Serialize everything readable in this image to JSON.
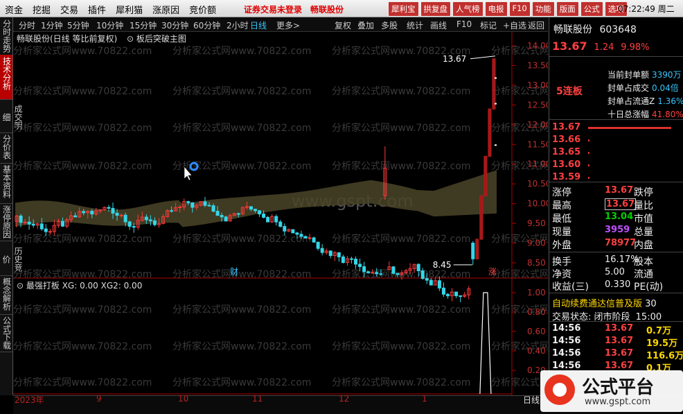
{
  "menubar": {
    "items": [
      "资金",
      "挖掘",
      "交易",
      "插件",
      "犀利猫",
      "涨原因",
      "竞价额"
    ],
    "notice_a": "证券交易未登录",
    "notice_b": "畅联股份",
    "sysbtns": [
      "犀利宝",
      "拱复盘",
      "人气榜",
      "电报",
      "F10",
      "功能",
      "版面",
      "公式",
      "选项"
    ],
    "clock": "07:22:49 周二"
  },
  "lefttabs": [
    "分时走势",
    "技术分析",
    "成交明细",
    "分价表",
    "基本资料",
    "涨停原因",
    "历史竞价",
    "概念解析",
    "公式下载"
  ],
  "periodbar": {
    "periods": [
      "分时",
      "1分钟",
      "5分钟",
      "10分钟",
      "15分钟",
      "30分钟",
      "60分钟",
      "2小时",
      "日线",
      "更多>"
    ],
    "tools": [
      "复权",
      "叠加",
      "多股",
      "统计",
      "画线",
      "F10",
      "标记",
      "+自选",
      "返回"
    ]
  },
  "chart": {
    "title": "畅联股份(日线 等比前复权)",
    "indicator": "板后突破主图",
    "sub_title": "最强打板 XG: 0.00 XG2: 0.00",
    "price_axis": [
      "14.00",
      "13.50",
      "13.00",
      "12.50",
      "12.00",
      "11.50",
      "11.00",
      "10.50",
      "10.00",
      "9.50",
      "9.00",
      "8.50"
    ],
    "sub_axis": [
      "1.00",
      "0.80",
      "0.60",
      "0.40",
      "0.20"
    ],
    "high_label": "13.67",
    "low_label": "8.45",
    "marker_cai": "财",
    "marker_zhang": "涨",
    "watermark": "分析家公式网www.70822.com",
    "watermark2": "www.gspt.com"
  },
  "axis_x": {
    "year": "2023年",
    "months": [
      "9",
      "10",
      "11",
      "12",
      "1"
    ],
    "right_label": "日线"
  },
  "stock": {
    "name": "畅联股份",
    "code": "603648",
    "price": "13.67",
    "change": "1.24",
    "pct": "9.98%",
    "board": "5连板",
    "stats": [
      {
        "label": "当前封单额",
        "value": "3390万"
      },
      {
        "label": "封单占成交",
        "value": "0.04倍"
      },
      {
        "label": "封单占流通Z",
        "value": "1.36%"
      },
      {
        "label": "十日总涨幅",
        "value": "41.80%"
      }
    ],
    "asks": [
      "13.67",
      "13.66",
      "13.65",
      "13.60",
      "13.59"
    ],
    "quote": [
      {
        "l": "涨停",
        "v": "13.67",
        "l2": "跌停"
      },
      {
        "l": "最高",
        "v": "13.67",
        "l2": "量比"
      },
      {
        "l": "最低",
        "v": "13.04",
        "l2": "市值"
      },
      {
        "l": "现量",
        "v": "3959",
        "l2": "总量"
      },
      {
        "l": "外盘",
        "v": "78977",
        "l2": "内盘"
      }
    ],
    "quote2": [
      {
        "l": "换手",
        "v": "16.17%",
        "l2": "股本"
      },
      {
        "l": "净资",
        "v": "5.00",
        "l2": "流通"
      },
      {
        "l": "收益(三)",
        "v": "0.330",
        "l2": "PE(动)"
      }
    ],
    "promo": "自动续费通达信普及版",
    "promo_tail": "30",
    "status": "交易状态: 闭市阶段",
    "status_time": "15:00",
    "ticks": [
      {
        "t": "14:56",
        "p": "13.67",
        "v": "0.7万"
      },
      {
        "t": "14:56",
        "p": "13.67",
        "v": "19.5万"
      },
      {
        "t": "14:56",
        "p": "13.67",
        "v": "116.6万"
      },
      {
        "t": "14:56",
        "p": "13.67",
        "v": "0.1万"
      }
    ]
  },
  "logo": {
    "name": "公式平台",
    "url": "www.gspt.com"
  }
}
